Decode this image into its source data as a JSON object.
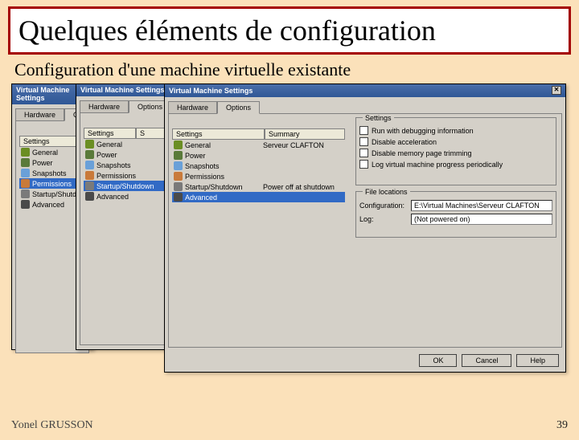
{
  "slide": {
    "title": "Quelques éléments de configuration",
    "subtitle": "Configuration d'une machine virtuelle existante",
    "footer_left": "Yonel GRUSSON",
    "footer_right": "39"
  },
  "dialog": {
    "title": "Virtual Machine Settings",
    "close_glyph": "✕",
    "tabs": {
      "hardware": "Hardware",
      "options": "Options"
    },
    "list_header": {
      "settings": "Settings",
      "summary": "Summary"
    },
    "items": [
      {
        "icon": "gear",
        "label": "General",
        "summary": "Serveur CLAFTON"
      },
      {
        "icon": "power",
        "label": "Power",
        "summary": ""
      },
      {
        "icon": "snap",
        "label": "Snapshots",
        "summary": ""
      },
      {
        "icon": "perm",
        "label": "Permissions",
        "summary": ""
      },
      {
        "icon": "startup",
        "label": "Startup/Shutdown",
        "summary": "Power off at shutdown"
      },
      {
        "icon": "adv",
        "label": "Advanced",
        "summary": ""
      }
    ],
    "selected": {
      "d1": 3,
      "d2": 4,
      "d3": 5
    },
    "settings_group": {
      "legend": "Settings",
      "checks": [
        "Run with debugging information",
        "Disable acceleration",
        "Disable memory page trimming",
        "Log virtual machine progress periodically"
      ]
    },
    "locations_group": {
      "legend": "File locations",
      "rows": [
        {
          "label": "Configuration:",
          "value": "E:\\Virtual Machines\\Serveur CLAFTON"
        },
        {
          "label": "Log:",
          "value": "(Not powered on)"
        }
      ]
    },
    "buttons": {
      "ok": "OK",
      "cancel": "Cancel",
      "help": "Help"
    }
  }
}
